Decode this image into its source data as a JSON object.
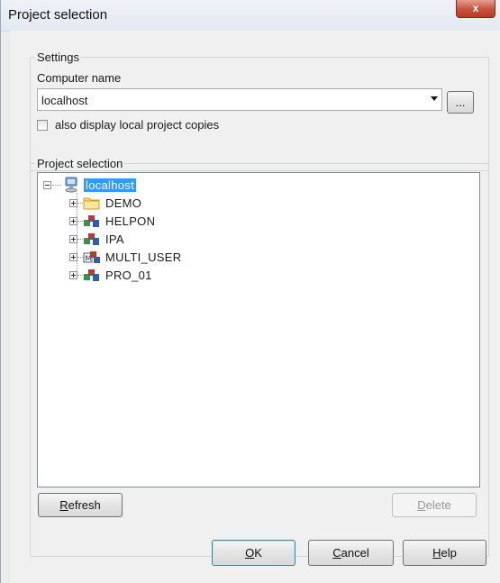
{
  "window": {
    "title": "Project selection",
    "close_label": "x"
  },
  "settings": {
    "group_label": "Settings",
    "computer_name_label": "Computer name",
    "computer_name_value": "localhost",
    "browse_label": "...",
    "checkbox_label": "also display local project copies",
    "checkbox_checked": false
  },
  "project_selection": {
    "group_label": "Project selection",
    "root": {
      "label": "localhost",
      "icon": "computer-icon",
      "expanded": true,
      "selected": true
    },
    "projects": [
      {
        "label": "DEMO",
        "icon": "folder-icon"
      },
      {
        "label": "HELPON",
        "icon": "project-icon"
      },
      {
        "label": "IPA",
        "icon": "project-icon"
      },
      {
        "label": "MULTI_USER",
        "icon": "multi-user-project-icon"
      },
      {
        "label": "PRO_01",
        "icon": "project-icon"
      }
    ],
    "refresh_label": "Refresh",
    "refresh_mnemonic": "R",
    "refresh_rest": "efresh",
    "delete_label": "Delete",
    "delete_mnemonic": "D",
    "delete_rest": "elete"
  },
  "footer": {
    "ok_mnemonic": "O",
    "ok_rest": "K",
    "cancel_mnemonic": "C",
    "cancel_rest": "ancel",
    "help_mnemonic": "H",
    "help_rest": "elp"
  }
}
